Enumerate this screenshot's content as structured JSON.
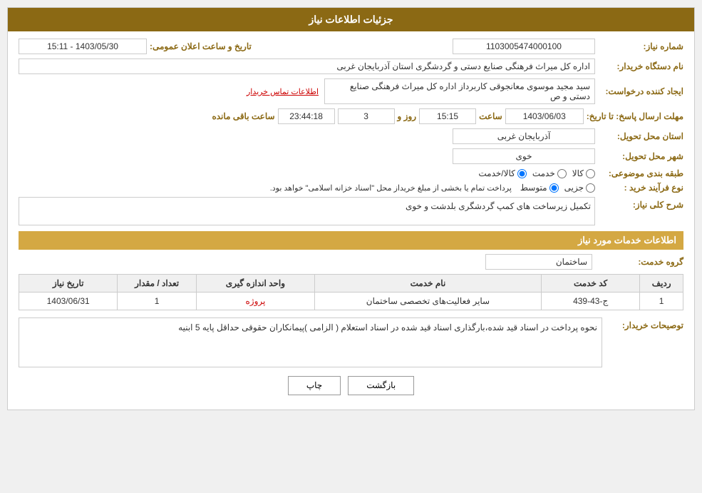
{
  "page": {
    "title": "جزئیات اطلاعات نیاز"
  },
  "header": {
    "need_number_label": "شماره نیاز:",
    "need_number_value": "1103005474000100",
    "announce_label": "تاریخ و ساعت اعلان عمومی:",
    "announce_value": "1403/05/30 - 15:11",
    "org_name_label": "نام دستگاه خریدار:",
    "org_name_value": "اداره کل میراث فرهنگی  صنایع دستی و گردشگری استان آذربایجان غربی",
    "creator_label": "ایجاد کننده درخواست:",
    "creator_value": "سید مجید موسوی معانجوقی کاربرداز اداره کل میراث فرهنگی  صنایع دستی و ص",
    "creator_link": "اطلاعات تماس خریدار",
    "deadline_label": "مهلت ارسال پاسخ: تا تاریخ:",
    "deadline_date": "1403/06/03",
    "deadline_time_label": "ساعت",
    "deadline_time": "15:15",
    "deadline_day_label": "روز و",
    "deadline_days": "3",
    "deadline_remaining_label": "ساعت باقی مانده",
    "deadline_remaining": "23:44:18",
    "province_label": "استان محل تحویل:",
    "province_value": "آذربایجان غربی",
    "city_label": "شهر محل تحویل:",
    "city_value": "خوی",
    "category_label": "طبقه بندی موضوعی:",
    "category_options": [
      {
        "label": "کالا",
        "checked": true
      },
      {
        "label": "خدمت",
        "checked": false
      },
      {
        "label": "کالا/خدمت",
        "checked": false
      }
    ],
    "purchase_type_label": "نوع فرآیند خرید :",
    "purchase_types": [
      {
        "label": "جزیی",
        "checked": false
      },
      {
        "label": "متوسط",
        "checked": true
      }
    ],
    "purchase_note": "پرداخت تمام یا بخشی از مبلغ خریداز محل \"اسناد خزانه اسلامی\" خواهد بود.",
    "need_desc_label": "شرح کلی نیاز:",
    "need_desc_value": "تکمیل زیرساخت های کمپ گردشگری بلدشت و خوی"
  },
  "services_section": {
    "title": "اطلاعات خدمات مورد نیاز",
    "group_label": "گروه خدمت:",
    "group_value": "ساختمان",
    "table": {
      "columns": [
        {
          "key": "row",
          "label": "ردیف"
        },
        {
          "key": "code",
          "label": "کد خدمت"
        },
        {
          "key": "name",
          "label": "نام خدمت"
        },
        {
          "key": "unit",
          "label": "واحد اندازه گیری"
        },
        {
          "key": "qty",
          "label": "تعداد / مقدار"
        },
        {
          "key": "date",
          "label": "تاریخ نیاز"
        }
      ],
      "rows": [
        {
          "row": "1",
          "code": "ج-43-439",
          "name": "سایر فعالیت‌های تخصصی ساختمان",
          "unit": "پروژه",
          "qty": "1",
          "date": "1403/06/31"
        }
      ]
    }
  },
  "buyer_notes_label": "توصیحات خریدار:",
  "buyer_notes_value": "نحوه پرداخت در اسناد قید شده،بارگذاری اسناد قید شده در اسناد استعلام ( الزامی )پیمانکاران حقوقی حداقل پایه 5 ابنیه",
  "buttons": {
    "print": "چاپ",
    "back": "بازگشت"
  }
}
